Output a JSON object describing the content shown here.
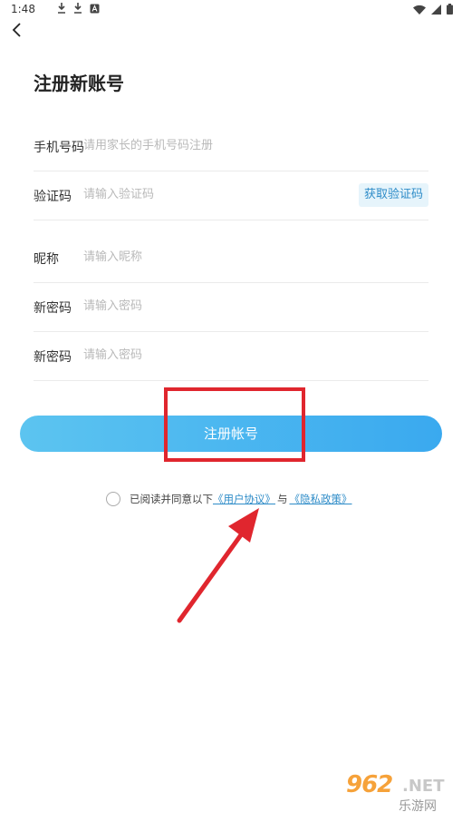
{
  "status_bar": {
    "time": "1:48",
    "left_icons": [
      "download-icon",
      "download-icon",
      "app-a-icon"
    ],
    "right_icons": [
      "wifi-icon",
      "signal-icon",
      "battery-icon"
    ]
  },
  "header": {
    "back_icon": "chevron-left-icon"
  },
  "page": {
    "title": "注册新账号"
  },
  "form": {
    "phone": {
      "label": "手机号码",
      "placeholder": "请用家长的手机号码注册",
      "value": ""
    },
    "code": {
      "label": "验证码",
      "placeholder": "请输入验证码",
      "value": "",
      "get_code_label": "获取验证码"
    },
    "nickname": {
      "label": "昵称",
      "placeholder": "请输入昵称",
      "value": ""
    },
    "password": {
      "label": "新密码",
      "placeholder": "请输入密码",
      "value": ""
    },
    "password_confirm": {
      "label": "新密码",
      "placeholder": "请输入密码",
      "value": ""
    }
  },
  "register_button": {
    "label": "注册帐号"
  },
  "agreement": {
    "prefix": "已阅读并同意以下",
    "user_agreement": "《用户协议》",
    "conjunction": "与",
    "privacy_policy": "《隐私政策》",
    "checked": false
  },
  "annotations": {
    "highlight_color": "#e0262e",
    "arrow_color": "#e0262e"
  },
  "watermark": {
    "top": "962",
    "net": ".NET",
    "bottom": "乐游网"
  },
  "colors": {
    "accent": "#3aa9ef",
    "link": "#2e8cc8"
  }
}
